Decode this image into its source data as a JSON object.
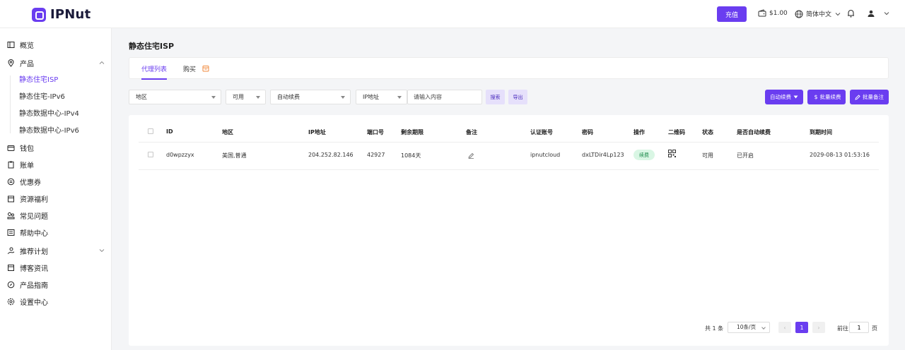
{
  "header": {
    "logo_text": "IPNut",
    "recharge_label": "充值",
    "balance": "$1.00",
    "language": "简体中文"
  },
  "sidebar": {
    "items": [
      {
        "label": "概览",
        "icon": "layout-icon"
      },
      {
        "label": "产品",
        "icon": "location-pin-icon"
      },
      {
        "label": "钱包",
        "icon": "wallet-icon"
      },
      {
        "label": "账单",
        "icon": "clipboard-icon"
      },
      {
        "label": "优惠券",
        "icon": "coupon-icon"
      },
      {
        "label": "资源福利",
        "icon": "gift-icon"
      },
      {
        "label": "常见问题",
        "icon": "help-icon"
      },
      {
        "label": "帮助中心",
        "icon": "book-icon"
      },
      {
        "label": "推荐计划",
        "icon": "hand-coin-icon"
      },
      {
        "label": "博客资讯",
        "icon": "news-icon"
      },
      {
        "label": "产品指南",
        "icon": "compass-icon"
      },
      {
        "label": "设置中心",
        "icon": "settings-icon"
      }
    ],
    "product_sub": [
      "静态住宅ISP",
      "静态住宅-IPv6",
      "静态数据中心-IPv4",
      "静态数据中心-IPv6"
    ]
  },
  "main": {
    "title": "静态住宅ISP",
    "tabs": [
      "代理列表",
      "购买"
    ],
    "filters": {
      "region": "地区",
      "status": "可用",
      "auto_renew": "自动续费",
      "field": "IP地址",
      "search_placeholder": "请输入内容",
      "search_btn": "搜索",
      "export_btn": "导出",
      "auto_renew_btn": "自动续费",
      "bulk_renew_btn": "批量续费",
      "bulk_note_btn": "批量备注"
    },
    "table": {
      "columns": [
        "ID",
        "地区",
        "IP地址",
        "端口号",
        "剩余期限",
        "备注",
        "认证账号",
        "密码",
        "操作",
        "二维码",
        "状态",
        "是否自动续费",
        "到期时间"
      ],
      "rows": [
        {
          "id": "d0wpzzyx",
          "region": "美国,普通",
          "ip": "204.252.82.146",
          "port": "42927",
          "remaining": "1084天",
          "account": "ipnutcloud",
          "password": "dxLTDir4Lp123",
          "action": "续费",
          "status": "可用",
          "auto_renew": "已开启",
          "expire": "2029-08-13 01:53:16"
        }
      ]
    },
    "pagination": {
      "total": "共 1 条",
      "page_size": "10条/页",
      "current": "1",
      "goto_label": "前往",
      "goto_value": "1",
      "page_unit": "页"
    }
  },
  "colors": {
    "accent": "#6a3df0",
    "badge_bg": "#d9f6e4",
    "badge_text": "#1c8b4b"
  }
}
